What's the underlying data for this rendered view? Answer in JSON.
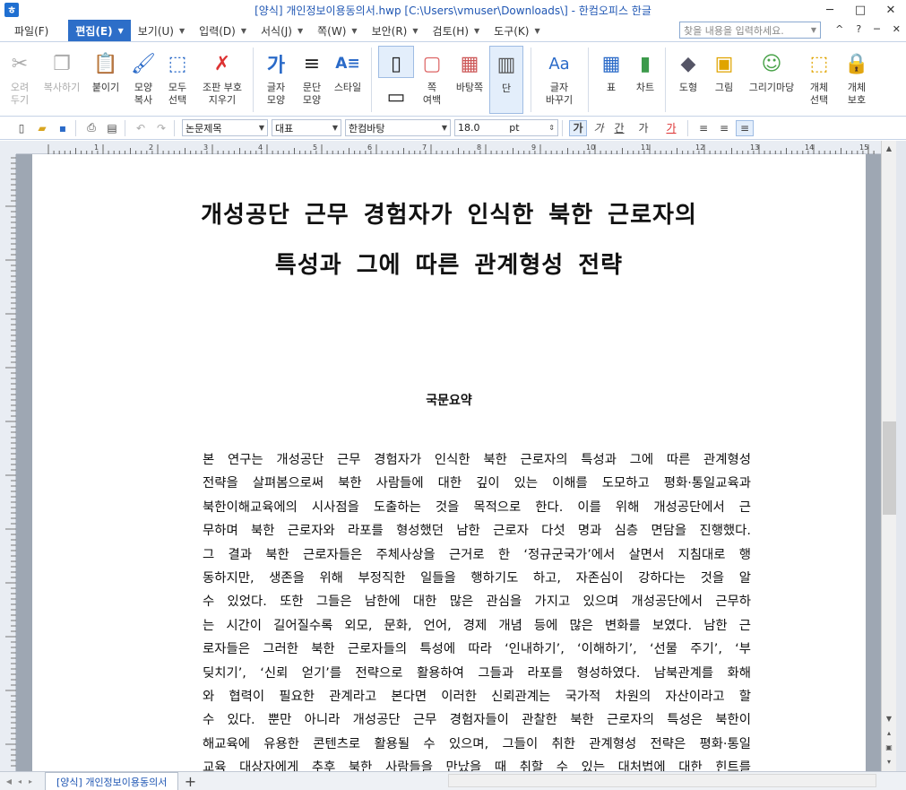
{
  "window": {
    "title": "[양식] 개인정보이용동의서.hwp [C:\\Users\\vmuser\\Downloads\\] - 한컴오피스 한글",
    "app_icon": "ㅎ",
    "controls": [
      "─",
      "□",
      "✕"
    ]
  },
  "menu": {
    "items": [
      {
        "label": "파일(F)",
        "active": false
      },
      {
        "label": "편집(E)",
        "active": true
      },
      {
        "label": "보기(U)",
        "active": false
      },
      {
        "label": "입력(D)",
        "active": false
      },
      {
        "label": "서식(J)",
        "active": false
      },
      {
        "label": "쪽(W)",
        "active": false
      },
      {
        "label": "보안(R)",
        "active": false
      },
      {
        "label": "검토(H)",
        "active": false
      },
      {
        "label": "도구(K)",
        "active": false
      }
    ],
    "search_placeholder": "찾을 내용을 입력하세요.",
    "right_controls": [
      "^",
      "?",
      "─",
      "✕"
    ]
  },
  "ribbon": {
    "buttons": [
      {
        "label": "오려\n두기",
        "icon": "✂",
        "disabled": true
      },
      {
        "label": "복사하기",
        "icon": "❐",
        "disabled": true
      },
      {
        "label": "붙이기",
        "icon": "📋",
        "disabled": false
      },
      {
        "label": "모양\n복사",
        "icon": "🖌",
        "disabled": false
      },
      {
        "label": "모두\n선택",
        "icon": "⬚",
        "disabled": false
      },
      {
        "label": "조판 부호\n지우기",
        "icon": "✗",
        "disabled": false
      },
      {
        "label": "글자\n모양",
        "icon": "가",
        "disabled": false
      },
      {
        "label": "문단\n모양",
        "icon": "≡",
        "disabled": false
      },
      {
        "label": "스타일",
        "icon": "A≡",
        "disabled": false
      },
      {
        "label": "쪽\n여백",
        "icon": "▢",
        "disabled": false
      },
      {
        "label": "바탕쪽",
        "icon": "▦",
        "disabled": false
      },
      {
        "label": "단",
        "icon": "▥",
        "disabled": false
      },
      {
        "label": "글자\n바꾸기",
        "icon": "Aa",
        "disabled": false
      },
      {
        "label": "표",
        "icon": "▦",
        "disabled": false
      },
      {
        "label": "차트",
        "icon": "▮",
        "disabled": false
      },
      {
        "label": "도형",
        "icon": "◆",
        "disabled": false
      },
      {
        "label": "그림",
        "icon": "▣",
        "disabled": false
      },
      {
        "label": "그리기마당",
        "icon": "☺",
        "disabled": false
      },
      {
        "label": "개체\n선택",
        "icon": "⬚",
        "disabled": false
      },
      {
        "label": "개체\n보호",
        "icon": "🔒",
        "disabled": false
      }
    ]
  },
  "format_toolbar": {
    "style": "논문제목",
    "outline": "대표",
    "font": "한컴바탕",
    "font_size": "18.0",
    "size_unit": "pt",
    "font_glyphs": [
      "가",
      "가",
      "간",
      "가",
      "가"
    ]
  },
  "ruler": {
    "marks": [
      "1",
      "2",
      "3",
      "4",
      "5",
      "6",
      "7",
      "8",
      "9",
      "10",
      "11",
      "12",
      "13",
      "14",
      "15",
      "16"
    ]
  },
  "document": {
    "title_line1": "개성공단 근무 경험자가 인식한 북한 근로자의",
    "title_line2": "특성과 그에 따른 관계형성 전략",
    "abstract_heading": "국문요약",
    "abstract_lines": [
      "본 연구는 개성공단 근무 경험자가 인식한 북한 근로자의 특성과 그에 따른 관계형성",
      "전략을 살펴봄으로써 북한 사람들에 대한 깊이 있는 이해를 도모하고 평화·통일교육과",
      "북한이해교육에의 시사점을 도출하는 것을 목적으로 한다. 이를 위해 개성공단에서 근",
      "무하며 북한 근로자와 라포를 형성했던 남한 근로자 다섯 명과 심층 면담을 진행했다.",
      "그 결과 북한 근로자들은 주체사상을 근거로 한 ‘정규군국가’에서 살면서 지침대로 행",
      "동하지만, 생존을 위해 부정직한 일들을 행하기도 하고, 자존심이 강하다는 것을 알",
      "수 있었다. 또한 그들은 남한에 대한 많은 관심을 가지고 있으며 개성공단에서 근무하",
      "는 시간이 길어질수록 외모, 문화, 언어, 경제 개념 등에 많은 변화를 보였다. 남한 근",
      "로자들은 그러한 북한 근로자들의 특성에 따라 ‘인내하기’, ‘이해하기’, ‘선물 주기’, ‘부",
      "딪치기’, ‘신뢰 얻기’를 전략으로 활용하여 그들과 라포를 형성하였다. 남북관계를 화해",
      "와 협력이 필요한 관계라고 본다면 이러한 신뢰관계는 국가적 차원의 자산이라고 할",
      "수 있다. 뿐만 아니라 개성공단 근무 경험자들이 관찰한 북한 근로자의 특성은 북한이",
      "해교육에 유용한 콘텐츠로 활용될 수 있으며, 그들이 취한 관계형성 전략은 평화·통일",
      "교육 대상자에게 추후 북한 사람들을 만났을 때 취할 수 있는 대처법에 대한 힌트를"
    ]
  },
  "bottom": {
    "doc_tab": "[양식] 개인정보이용동의서",
    "add_tab": "+"
  }
}
